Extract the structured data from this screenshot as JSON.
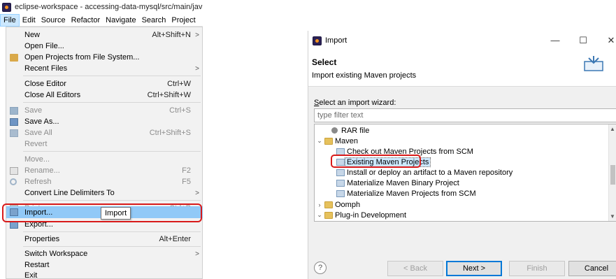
{
  "eclipse": {
    "window_title": "eclipse-workspace - accessing-data-mysql/src/main/java",
    "menubar": [
      "File",
      "Edit",
      "Source",
      "Refactor",
      "Navigate",
      "Search",
      "Project"
    ],
    "file_menu": {
      "new": {
        "label": "New",
        "accel": "Alt+Shift+N",
        "submenu": ">"
      },
      "open_file": {
        "label": "Open File..."
      },
      "open_projects": {
        "label": "Open Projects from File System..."
      },
      "recent_files": {
        "label": "Recent Files",
        "submenu": ">"
      },
      "close_editor": {
        "label": "Close Editor",
        "accel": "Ctrl+W"
      },
      "close_all": {
        "label": "Close All Editors",
        "accel": "Ctrl+Shift+W"
      },
      "save": {
        "label": "Save",
        "accel": "Ctrl+S"
      },
      "save_as": {
        "label": "Save As..."
      },
      "save_all": {
        "label": "Save All",
        "accel": "Ctrl+Shift+S"
      },
      "revert": {
        "label": "Revert"
      },
      "move": {
        "label": "Move..."
      },
      "rename": {
        "label": "Rename...",
        "accel": "F2"
      },
      "refresh": {
        "label": "Refresh",
        "accel": "F5"
      },
      "convert": {
        "label": "Convert Line Delimiters To",
        "submenu": ">"
      },
      "print": {
        "label": "Print...",
        "accel": "Ctrl+P"
      },
      "import": {
        "label": "Import...",
        "tooltip": "Import"
      },
      "export": {
        "label": "Export..."
      },
      "properties": {
        "label": "Properties",
        "accel": "Alt+Enter"
      },
      "switch_ws": {
        "label": "Switch Workspace",
        "submenu": ">"
      },
      "restart": {
        "label": "Restart"
      },
      "exit": {
        "label": "Exit"
      }
    }
  },
  "dialog": {
    "title": "Import",
    "header_title": "Select",
    "header_desc": "Import existing Maven projects",
    "wizard_label_first": "S",
    "wizard_label_rest": "elect an import wizard:",
    "filter_placeholder": "type filter text",
    "tree": {
      "rar": "RAR file",
      "maven": "Maven",
      "checkout": "Check out Maven Projects from SCM",
      "existing": "Existing Maven Projects",
      "install": "Install or deploy an artifact to a Maven repository",
      "binary": "Materialize Maven Binary Project",
      "from_scm": "Materialize Maven Projects from SCM",
      "oomph": "Oomph",
      "plugin": "Plug-in Development"
    },
    "buttons": {
      "help": "?",
      "back": "< Back",
      "back_mnemonic": "B",
      "next": "Next >",
      "next_mnemonic": "N",
      "finish": "Finish",
      "finish_mnemonic": "F",
      "cancel": "Cancel"
    },
    "window_controls": {
      "minimize": "—",
      "maximize": "☐",
      "close": "✕"
    }
  },
  "colors": {
    "highlight_red": "#d81a1a",
    "menu_selection": "#91c9f7",
    "tree_selection": "#cce8ff"
  }
}
